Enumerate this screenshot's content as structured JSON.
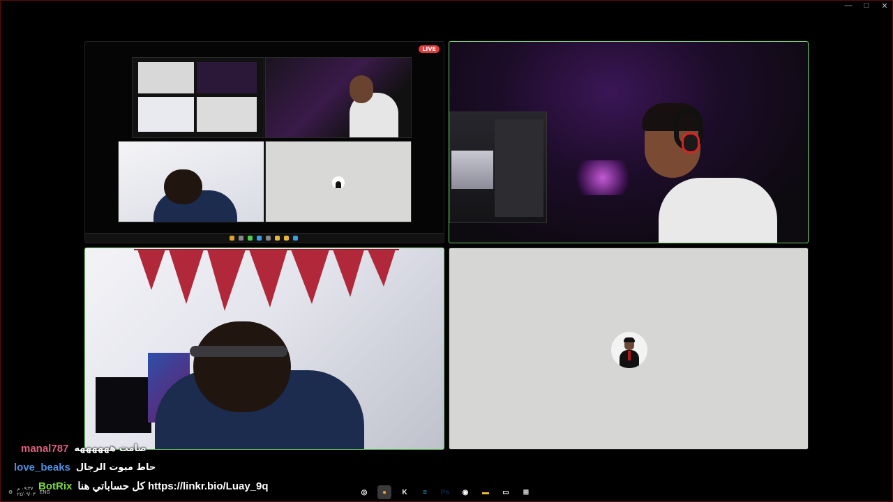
{
  "window": {
    "controls": [
      "minimize",
      "maximize",
      "close"
    ],
    "control_glyphs": [
      "—",
      "□",
      "✕"
    ]
  },
  "tiles": {
    "share": {
      "badge": "LIVE"
    },
    "avatar": {
      "icon": "person-avatar-icon"
    }
  },
  "chat": [
    {
      "user": "manal787",
      "user_color": "#e0607e",
      "message": "صامت ههههههه"
    },
    {
      "user": "love_beaks",
      "user_color": "#4f8fe0",
      "message": "حاط ميوت الرجال"
    },
    {
      "user": "BotRix",
      "user_color": "#7cdc3c",
      "message": "كل حساباتي هنا https://linkr.bio/Luay_9q"
    }
  ],
  "taskbar": {
    "clock_time": "٠٩:٣٧ م",
    "clock_date": "٢٤/٠٩/٠٣",
    "language": "ENG",
    "apps": [
      {
        "name": "obs-icon",
        "glyph": "◎",
        "color": "transparent",
        "active": false
      },
      {
        "name": "discord-icon",
        "glyph": "●",
        "color": "#f0a03a",
        "active": true
      },
      {
        "name": "kick-icon",
        "glyph": "K",
        "color": "transparent",
        "active": false
      },
      {
        "name": "notepad-icon",
        "glyph": "≡",
        "color": "#3aa0e0",
        "active": false
      },
      {
        "name": "photoshop-icon",
        "glyph": "Ps",
        "color": "#0b2a4a",
        "active": false
      },
      {
        "name": "chrome-icon",
        "glyph": "◉",
        "color": "transparent",
        "active": false
      },
      {
        "name": "file-explorer-icon",
        "glyph": "▬",
        "color": "#e8b63a",
        "active": false
      },
      {
        "name": "window-switcher-icon",
        "glyph": "▭",
        "color": "transparent",
        "active": false
      },
      {
        "name": "start-icon",
        "glyph": "⊞",
        "color": "transparent",
        "active": false
      }
    ]
  },
  "colors": {
    "active_border": "#6fd36f",
    "live_badge": "#e43b3b",
    "avatar_bg": "#d6d6d4"
  }
}
